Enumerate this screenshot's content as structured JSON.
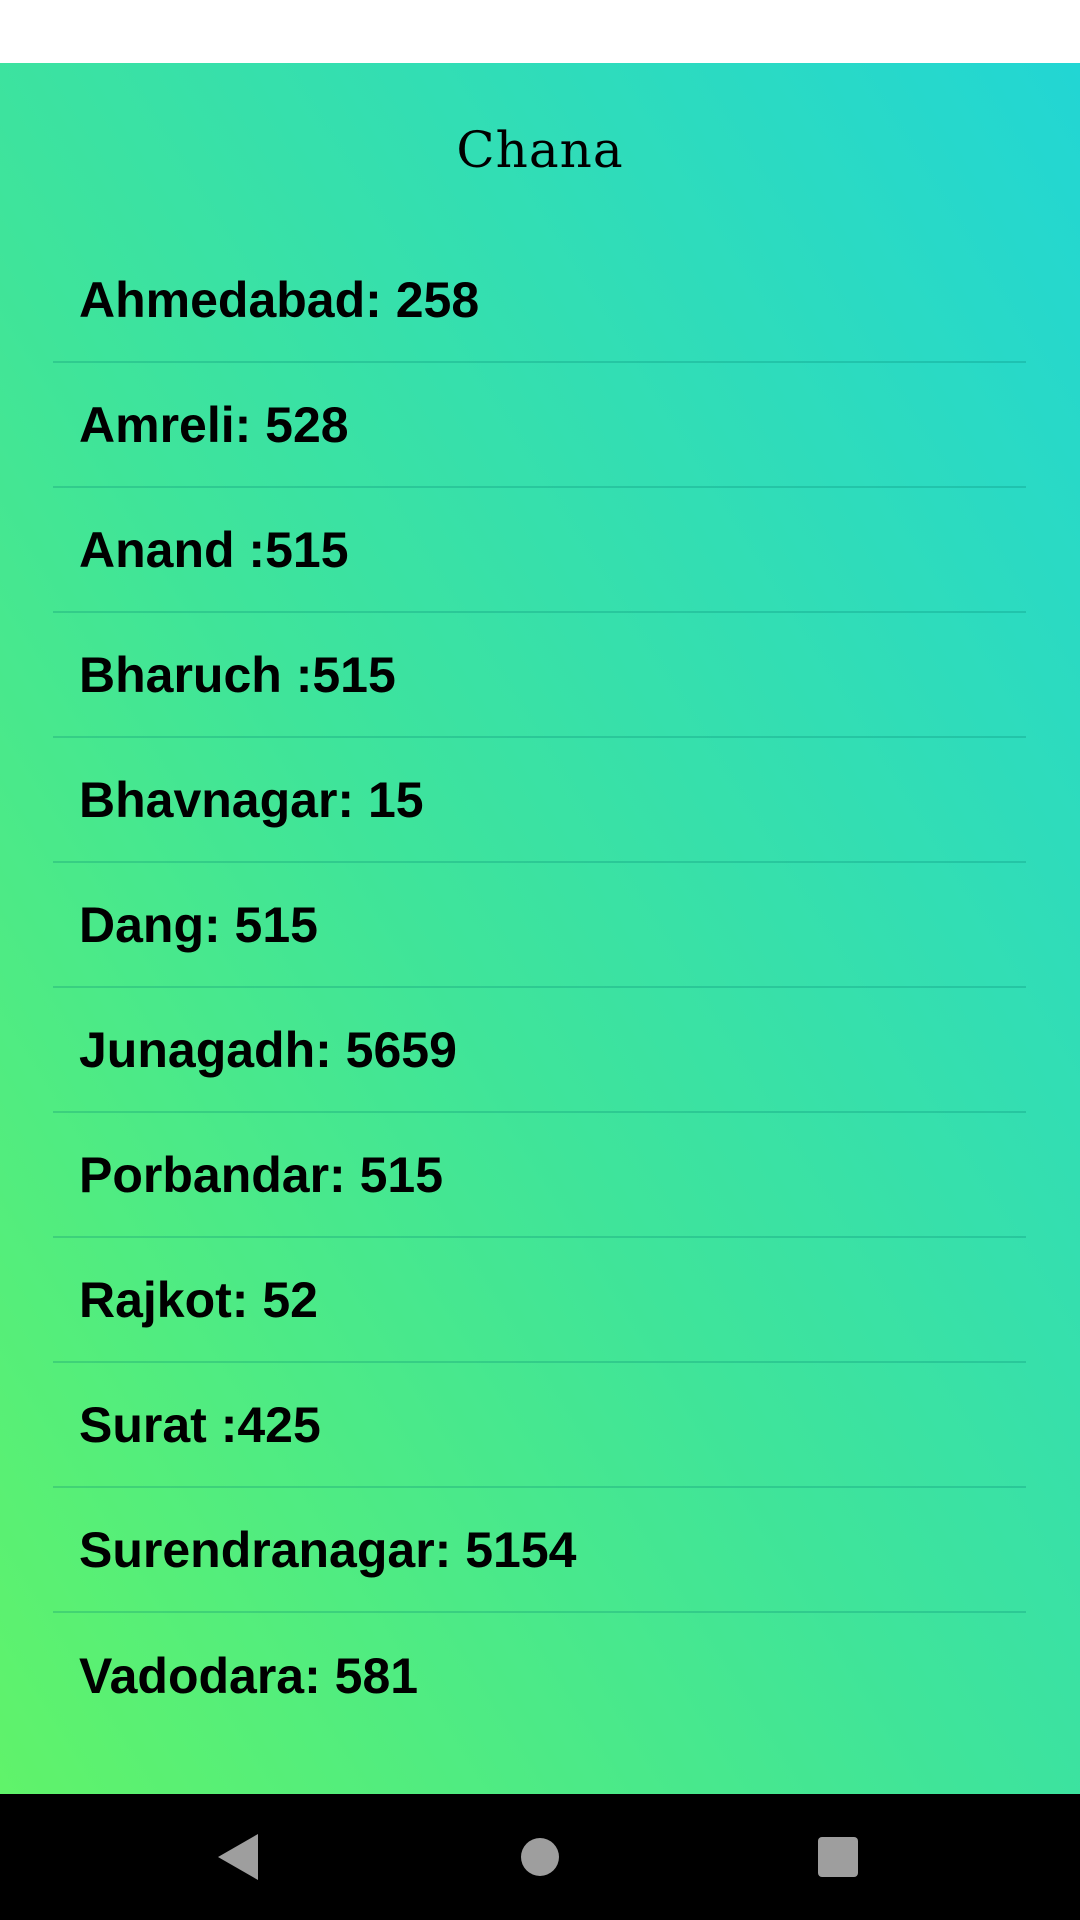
{
  "app": {
    "title": "Chana"
  },
  "colors": {
    "gradient_bottom_left": "#60f36a",
    "gradient_top_right": "#22d6d4",
    "text": "#000000",
    "nav_bar": "#000000",
    "nav_icon": "#9e9e9e"
  },
  "districts": [
    {
      "label": "Ahmedabad: 258"
    },
    {
      "label": "Amreli: 528"
    },
    {
      "label": "Anand :515"
    },
    {
      "label": "Bharuch :515"
    },
    {
      "label": "Bhavnagar: 15"
    },
    {
      "label": "Dang: 515"
    },
    {
      "label": "Junagadh: 5659"
    },
    {
      "label": "Porbandar: 515"
    },
    {
      "label": "Rajkot: 52"
    },
    {
      "label": "Surat :425"
    },
    {
      "label": "Surendranagar: 5154"
    },
    {
      "label": "Vadodara: 581"
    }
  ],
  "nav": {
    "back_icon": "triangle-left",
    "home_icon": "circle",
    "recents_icon": "square"
  }
}
